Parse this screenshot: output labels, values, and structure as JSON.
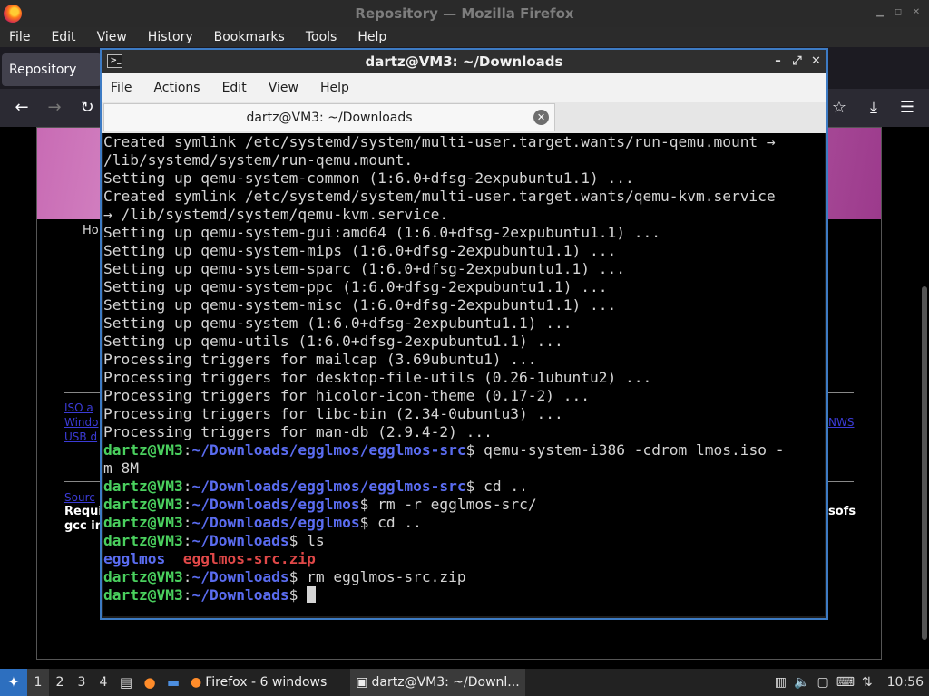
{
  "firefox": {
    "window_title": "Repository — Mozilla Firefox",
    "menu": [
      "File",
      "Edit",
      "View",
      "History",
      "Bookmarks",
      "Tools",
      "Help"
    ],
    "tab_label": "Repository",
    "page": {
      "home_fragment": "Ho",
      "link_fragments": [
        "ISO a",
        "Windo",
        "USB d",
        "NWS"
      ],
      "source_fragment": "Sourc",
      "requires_fragment": "Requi",
      "gcc_fragment": "gcc in",
      "sofs_fragment": "sofs"
    }
  },
  "terminal": {
    "window_title": "dartz@VM3: ~/Downloads",
    "menu": [
      "File",
      "Actions",
      "Edit",
      "View",
      "Help"
    ],
    "tab_label": "dartz@VM3: ~/Downloads",
    "lines": [
      {
        "type": "out",
        "text": "Created symlink /etc/systemd/system/multi-user.target.wants/run-qemu.mount →"
      },
      {
        "type": "out",
        "text": "/lib/systemd/system/run-qemu.mount."
      },
      {
        "type": "out",
        "text": "Setting up qemu-system-common (1:6.0+dfsg-2expubuntu1.1) ..."
      },
      {
        "type": "out",
        "text": "Created symlink /etc/systemd/system/multi-user.target.wants/qemu-kvm.service"
      },
      {
        "type": "out",
        "text": "→ /lib/systemd/system/qemu-kvm.service."
      },
      {
        "type": "out",
        "text": "Setting up qemu-system-gui:amd64 (1:6.0+dfsg-2expubuntu1.1) ..."
      },
      {
        "type": "out",
        "text": "Setting up qemu-system-mips (1:6.0+dfsg-2expubuntu1.1) ..."
      },
      {
        "type": "out",
        "text": "Setting up qemu-system-sparc (1:6.0+dfsg-2expubuntu1.1) ..."
      },
      {
        "type": "out",
        "text": "Setting up qemu-system-ppc (1:6.0+dfsg-2expubuntu1.1) ..."
      },
      {
        "type": "out",
        "text": "Setting up qemu-system-misc (1:6.0+dfsg-2expubuntu1.1) ..."
      },
      {
        "type": "out",
        "text": "Setting up qemu-system (1:6.0+dfsg-2expubuntu1.1) ..."
      },
      {
        "type": "out",
        "text": "Setting up qemu-utils (1:6.0+dfsg-2expubuntu1.1) ..."
      },
      {
        "type": "out",
        "text": "Processing triggers for mailcap (3.69ubuntu1) ..."
      },
      {
        "type": "out",
        "text": "Processing triggers for desktop-file-utils (0.26-1ubuntu2) ..."
      },
      {
        "type": "out",
        "text": "Processing triggers for hicolor-icon-theme (0.17-2) ..."
      },
      {
        "type": "out",
        "text": "Processing triggers for libc-bin (2.34-0ubuntu3) ..."
      },
      {
        "type": "out",
        "text": "Processing triggers for man-db (2.9.4-2) ..."
      },
      {
        "type": "prompt",
        "user": "dartz@VM3",
        "path": "~/Downloads/egglmos/egglmos-src",
        "cmd": " qemu-system-i386 -cdrom lmos.iso -"
      },
      {
        "type": "out",
        "text": "m 8M"
      },
      {
        "type": "prompt",
        "user": "dartz@VM3",
        "path": "~/Downloads/egglmos/egglmos-src",
        "cmd": " cd .."
      },
      {
        "type": "prompt",
        "user": "dartz@VM3",
        "path": "~/Downloads/egglmos",
        "cmd": " rm -r egglmos-src/"
      },
      {
        "type": "prompt",
        "user": "dartz@VM3",
        "path": "~/Downloads/egglmos",
        "cmd": " cd .."
      },
      {
        "type": "prompt",
        "user": "dartz@VM3",
        "path": "~/Downloads",
        "cmd": " ls"
      },
      {
        "type": "ls",
        "dir": "egglmos",
        "sep": "  ",
        "zip": "egglmos-src.zip"
      },
      {
        "type": "prompt",
        "user": "dartz@VM3",
        "path": "~/Downloads",
        "cmd": " rm egglmos-src.zip"
      },
      {
        "type": "prompt",
        "user": "dartz@VM3",
        "path": "~/Downloads",
        "cmd": " ",
        "cursor": true
      }
    ]
  },
  "taskbar": {
    "workspaces": [
      "1",
      "2",
      "3",
      "4"
    ],
    "firefox_task": "Firefox - 6 windows",
    "terminal_task": "dartz@VM3: ~/Downl...",
    "clock": "10:56"
  }
}
